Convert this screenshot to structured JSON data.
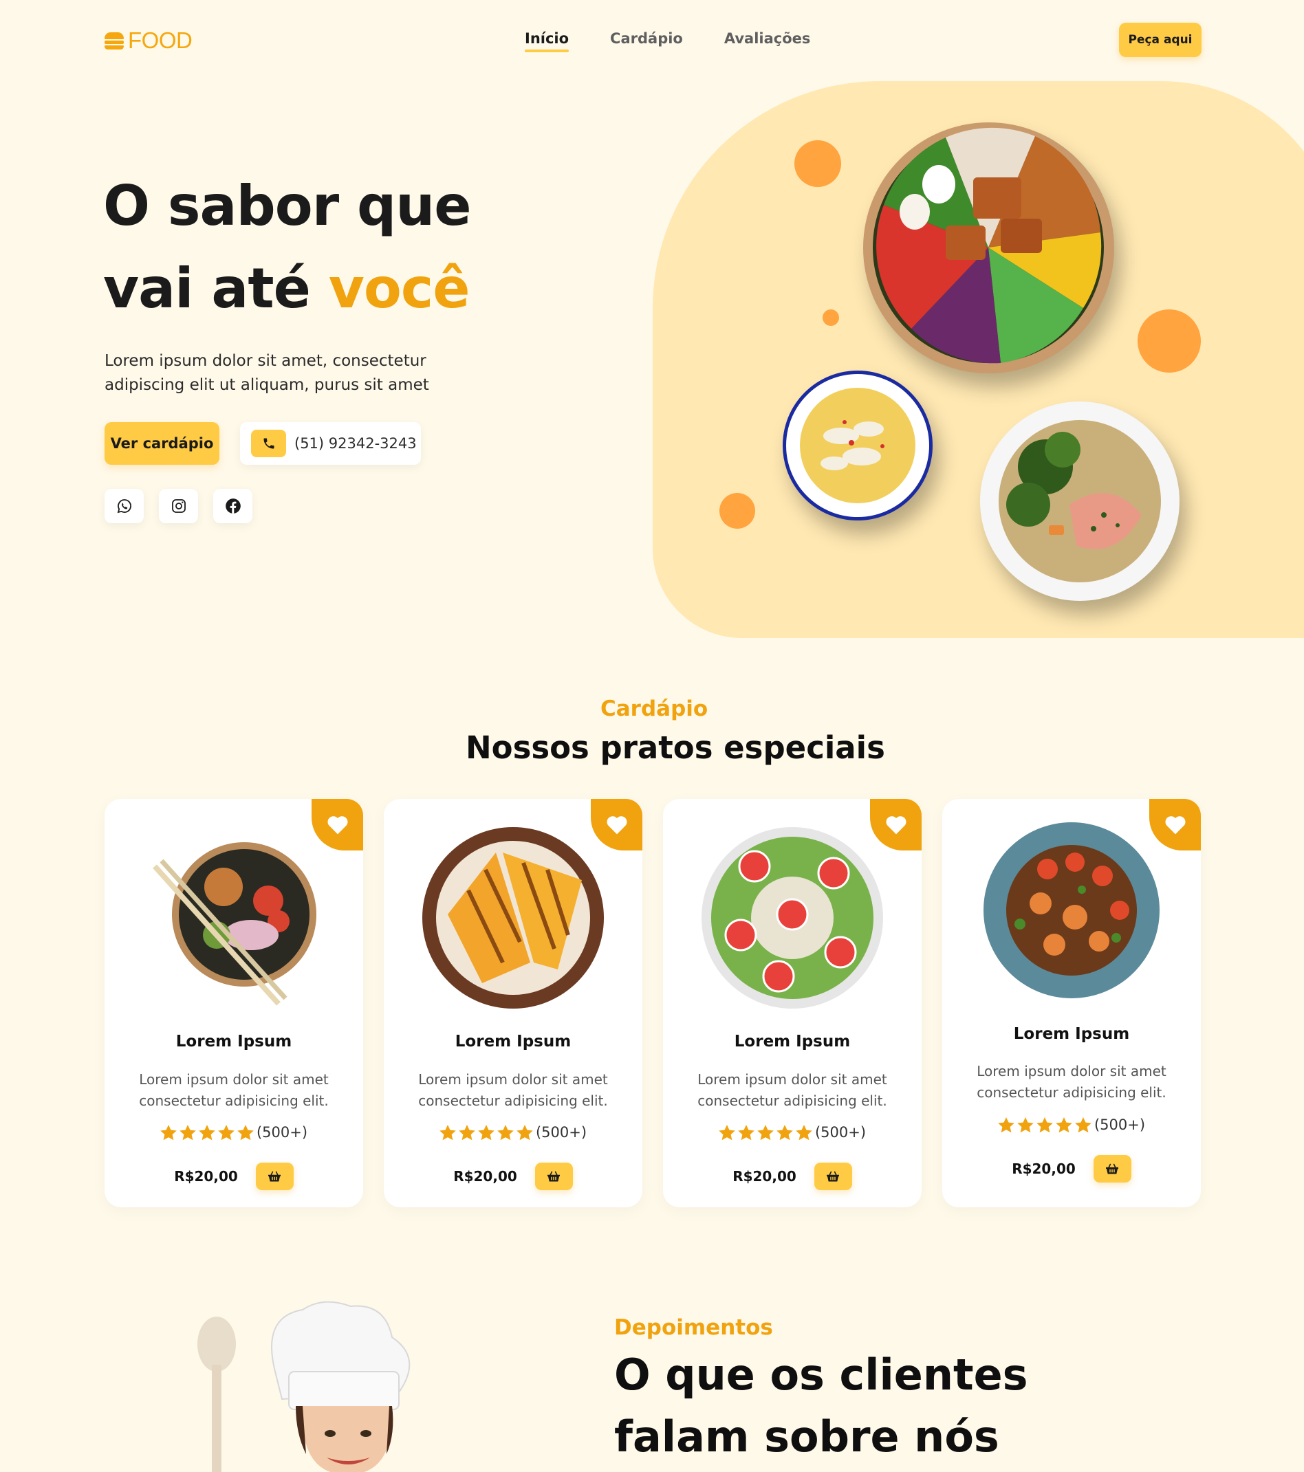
{
  "header": {
    "logo_text": "FOOD",
    "nav": [
      {
        "label": "Início",
        "active": true
      },
      {
        "label": "Cardápio",
        "active": false
      },
      {
        "label": "Avaliações",
        "active": false
      }
    ],
    "cta_label": "Peça aqui"
  },
  "hero": {
    "title_line1": "O sabor que",
    "title_line2_start": "vai até",
    "title_line2_accent": "você",
    "description": "Lorem ipsum dolor sit amet, consectetur adipiscing elit ut aliquam, purus sit amet",
    "menu_button": "Ver cardápio",
    "phone": "(51) 92342-3243",
    "social_icons": [
      "whatsapp-icon",
      "instagram-icon",
      "facebook-icon"
    ]
  },
  "menu": {
    "kicker": "Cardápio",
    "title": "Nossos pratos especiais",
    "items": [
      {
        "name": "Lorem Ipsum",
        "description": "Lorem ipsum dolor sit amet consectetur adipisicing elit.",
        "rating": 5,
        "reviews": "(500+)",
        "price": "R$20,00",
        "photo": "noodle-bowl"
      },
      {
        "name": "Lorem Ipsum",
        "description": "Lorem ipsum dolor sit amet consectetur adipisicing elit.",
        "rating": 5,
        "reviews": "(500+)",
        "price": "R$20,00",
        "photo": "sandwich-plate"
      },
      {
        "name": "Lorem Ipsum",
        "description": "Lorem ipsum dolor sit amet consectetur adipisicing elit.",
        "rating": 5,
        "reviews": "(500+)",
        "price": "R$20,00",
        "photo": "fruit-bowl"
      },
      {
        "name": "Lorem Ipsum",
        "description": "Lorem ipsum dolor sit amet consectetur adipisicing elit.",
        "rating": 5,
        "reviews": "(500+)",
        "price": "R$20,00",
        "photo": "shrimp-noodles"
      }
    ]
  },
  "testimonials": {
    "kicker": "Depoimentos",
    "title": "O que os clientes falam sobre nós"
  },
  "colors": {
    "background": "#fff9ea",
    "accent": "#f0a30e",
    "button": "#ffcb45",
    "blob": "#ffe8b2",
    "dot": "#ffa43e"
  }
}
